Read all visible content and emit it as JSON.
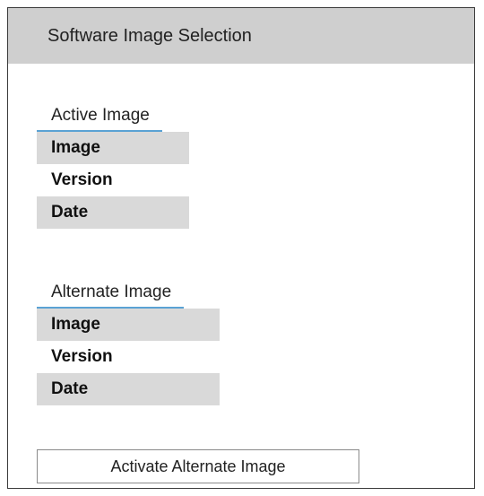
{
  "header": {
    "title": "Software Image Selection"
  },
  "active_image": {
    "title": "Active Image",
    "fields": {
      "image_label": "Image",
      "version_label": "Version",
      "date_label": "Date"
    }
  },
  "alternate_image": {
    "title": "Alternate Image",
    "fields": {
      "image_label": "Image",
      "version_label": "Version",
      "date_label": "Date"
    }
  },
  "actions": {
    "activate_label": "Activate Alternate Image"
  },
  "colors": {
    "header_background": "#cfcfcf",
    "row_shading": "#d9d9d9",
    "section_underline": "#5aa2d4"
  }
}
